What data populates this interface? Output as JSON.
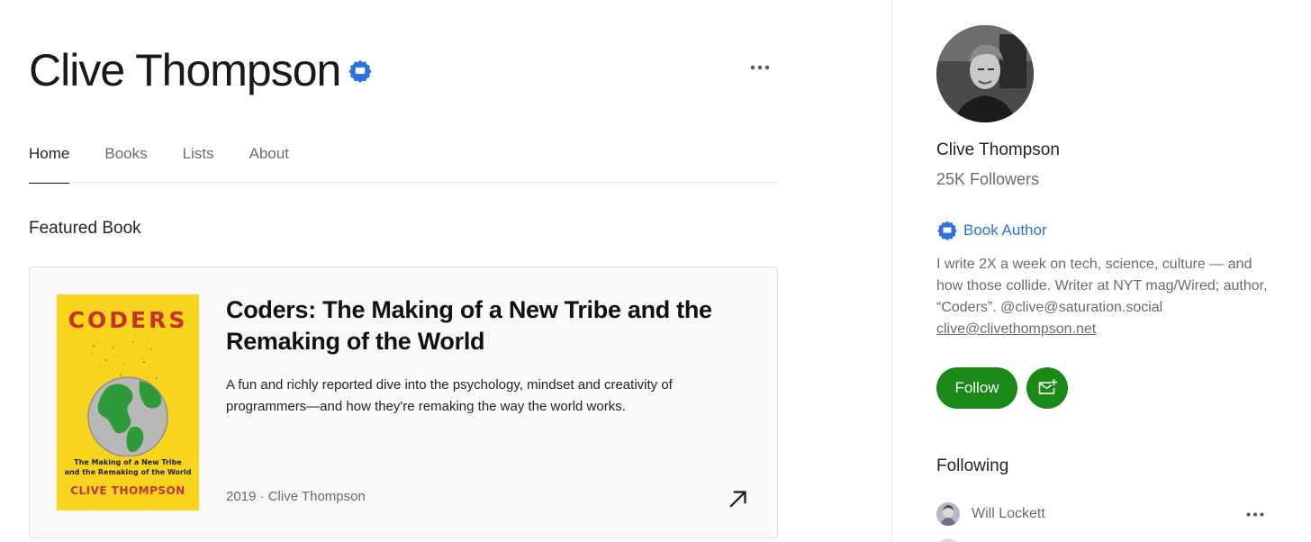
{
  "profile": {
    "name": "Clive Thompson",
    "followers": "25K Followers",
    "role_label": "Book Author",
    "bio": "I write 2X a week on tech, science, culture — and how those collide. Writer at NYT mag/Wired; author, “Coders”. @clive@saturation.social",
    "bio_email": "clive@clivethompson.net",
    "follow_label": "Follow"
  },
  "tabs": [
    {
      "label": "Home",
      "active": true
    },
    {
      "label": "Books",
      "active": false
    },
    {
      "label": "Lists",
      "active": false
    },
    {
      "label": "About",
      "active": false
    }
  ],
  "featured": {
    "section_title": "Featured Book",
    "title": "Coders: The Making of a New Tribe and the Remaking of the World",
    "description": "A fun and richly reported dive into the psychology, mindset and creativity of programmers—and how they're remaking the way the world works.",
    "meta": "2019 · Clive Thompson",
    "cover": {
      "title": "CODERS",
      "subtitle_line1": "The Making of a New Tribe",
      "subtitle_line2": "and the Remaking of the World",
      "author": "CLIVE THOMPSON"
    }
  },
  "following": {
    "title": "Following",
    "items": [
      {
        "name": "Will Lockett"
      }
    ]
  },
  "colors": {
    "accent_green": "#1a8917",
    "badge_blue": "#2f6fe0",
    "cover_yellow": "#f8d51c",
    "cover_red": "#c6312a"
  },
  "icons": {
    "verified": "book-author-badge-icon",
    "more": "more-horizontal-icon",
    "open": "arrow-up-right-icon",
    "subscribe": "mail-plus-icon"
  }
}
